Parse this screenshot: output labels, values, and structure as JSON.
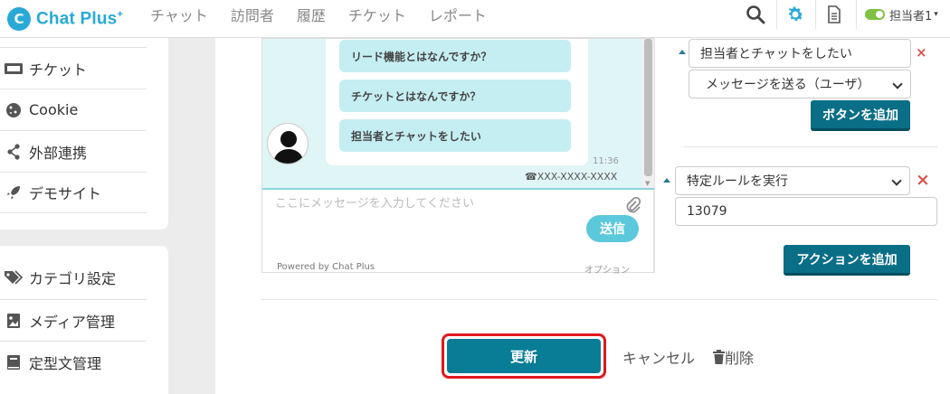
{
  "app": {
    "logo_letter": "C",
    "name": "Chat Plus",
    "name_sup": "+"
  },
  "nav": {
    "items": [
      {
        "label": "チャット"
      },
      {
        "label": "訪問者"
      },
      {
        "label": "履歴"
      },
      {
        "label": "チケット"
      },
      {
        "label": "レポート"
      }
    ]
  },
  "toolbar": {
    "icons": [
      "search-icon",
      "gear-icon",
      "document-icon"
    ],
    "accent": "#29a9d8"
  },
  "user": {
    "name": "担当者1",
    "caret": "▾",
    "status_color": "#7dc242"
  },
  "sidebar": {
    "group1": [
      {
        "label": "チケット",
        "icon": "ticket-icon"
      },
      {
        "label": "Cookie",
        "icon": "cookie-icon"
      },
      {
        "label": "外部連携",
        "icon": "share-icon"
      },
      {
        "label": "デモサイト",
        "icon": "rocket-icon"
      }
    ],
    "group2": [
      {
        "label": "カテゴリ設定",
        "icon": "tag-icon"
      },
      {
        "label": "メディア管理",
        "icon": "image-icon"
      },
      {
        "label": "定型文管理",
        "icon": "book-icon"
      }
    ]
  },
  "preview": {
    "bubbles": [
      "リード機能とはなんですか？",
      "チケットとはなんですか？",
      "担当者とチャットをしたい"
    ],
    "time": "11:36",
    "phone": "XXX-XXXX-XXXX",
    "input_placeholder": "ここにメッセージを入力してください",
    "send_label": "送信",
    "powered_by": "Powered by Chat Plus",
    "option_label": "オプション"
  },
  "settings": {
    "button_text_value": "担当者とチャットをしたい",
    "button_action_select": "メッセージを送る（ユーザ）",
    "add_button_label": "ボタンを追加",
    "rule_select": "特定ルールを実行",
    "rule_value": "13079",
    "add_action_label": "アクションを追加",
    "delete_mark": "×"
  },
  "footer": {
    "update_label": "更新",
    "cancel_label": "キャンセル",
    "delete_label": "削除",
    "highlight_color": "#e0191e"
  }
}
